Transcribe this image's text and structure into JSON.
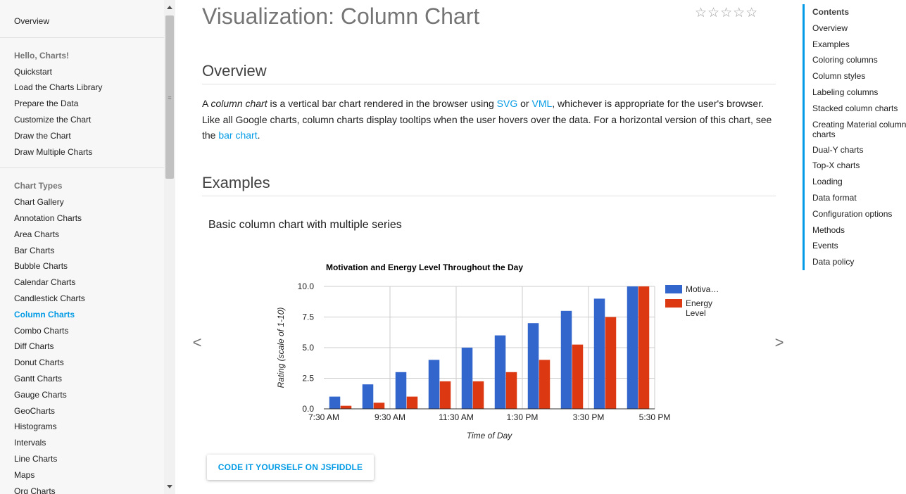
{
  "leftnav": {
    "top_item": "Overview",
    "group1_head": "Hello, Charts!",
    "group1": [
      "Quickstart",
      "Load the Charts Library",
      "Prepare the Data",
      "Customize the Chart",
      "Draw the Chart",
      "Draw Multiple Charts"
    ],
    "group2_head": "Chart Types",
    "group2": [
      "Chart Gallery",
      "Annotation Charts",
      "Area Charts",
      "Bar Charts",
      "Bubble Charts",
      "Calendar Charts",
      "Candlestick Charts",
      "Column Charts",
      "Combo Charts",
      "Diff Charts",
      "Donut Charts",
      "Gantt Charts",
      "Gauge Charts",
      "GeoCharts",
      "Histograms",
      "Intervals",
      "Line Charts",
      "Maps",
      "Org Charts"
    ],
    "active": "Column Charts"
  },
  "main": {
    "title": "Visualization: Column Chart",
    "stars": "☆☆☆☆☆",
    "overview_title": "Overview",
    "para_a": "A ",
    "para_em": "column chart",
    "para_b": " is a vertical bar chart rendered in the browser using ",
    "link_svg": "SVG",
    "para_c": " or ",
    "link_vml": "VML",
    "para_d": ", whichever is appropriate for the user's browser. Like all Google charts, column charts display tooltips when the user hovers over the data. For a horizontal version of this chart, see the ",
    "link_bar": "bar chart",
    "para_e": ".",
    "examples_title": "Examples",
    "subhead": "Basic column chart with multiple series",
    "prev_arrow": "<",
    "next_arrow": ">",
    "button": "CODE IT YOURSELF ON JSFIDDLE"
  },
  "toc": {
    "head": "Contents",
    "items": [
      "Overview",
      "Examples",
      "Coloring columns",
      "Column styles",
      "Labeling columns",
      "Stacked column charts",
      "Creating Material column charts",
      "Dual-Y charts",
      "Top-X charts",
      "Loading",
      "Data format",
      "Configuration options",
      "Methods",
      "Events",
      "Data policy"
    ]
  },
  "chart_data": {
    "type": "bar",
    "title": "Motivation and Energy Level Throughout the Day",
    "xlabel": "Time of Day",
    "ylabel": "Rating (scale of 1-10)",
    "ylim": [
      0,
      10
    ],
    "yticks": [
      "0.0",
      "2.5",
      "5.0",
      "7.5",
      "10.0"
    ],
    "xticks": [
      "7:30 AM",
      "9:30 AM",
      "11:30 AM",
      "1:30 PM",
      "3:30 PM",
      "5:30 PM"
    ],
    "series": [
      {
        "name": "Motiva…",
        "color": "#3366cc",
        "values": [
          1,
          2,
          3,
          4,
          5,
          6,
          7,
          8,
          9,
          10
        ]
      },
      {
        "name": "Energy Level",
        "color": "#dc3912",
        "values": [
          0.25,
          0.5,
          1,
          2.25,
          2.25,
          3,
          4,
          5.25,
          7.5,
          10
        ]
      }
    ],
    "legend": "right",
    "grid": true
  }
}
